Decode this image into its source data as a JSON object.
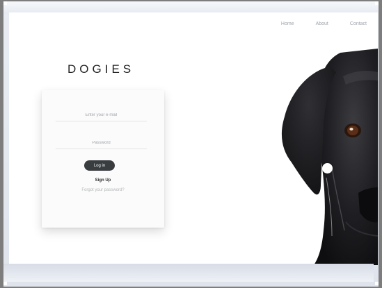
{
  "nav": {
    "items": [
      {
        "label": "Home"
      },
      {
        "label": "About"
      },
      {
        "label": "Contact"
      }
    ]
  },
  "brand": {
    "logo_text": "DOGIES"
  },
  "login_form": {
    "email_placeholder": "Enter your e-mail",
    "password_placeholder": "Password",
    "login_label": "Log in",
    "signup_label": "Sign Up",
    "forgot_label": "Forgot your password?"
  },
  "hero": {
    "image_subject": "black-labrador-dog-photo"
  },
  "colors": {
    "page_background": "#ffffff",
    "button": "#3a3d40",
    "nav_text": "#9ea3aa",
    "outer_background": "#7d7d7d"
  }
}
